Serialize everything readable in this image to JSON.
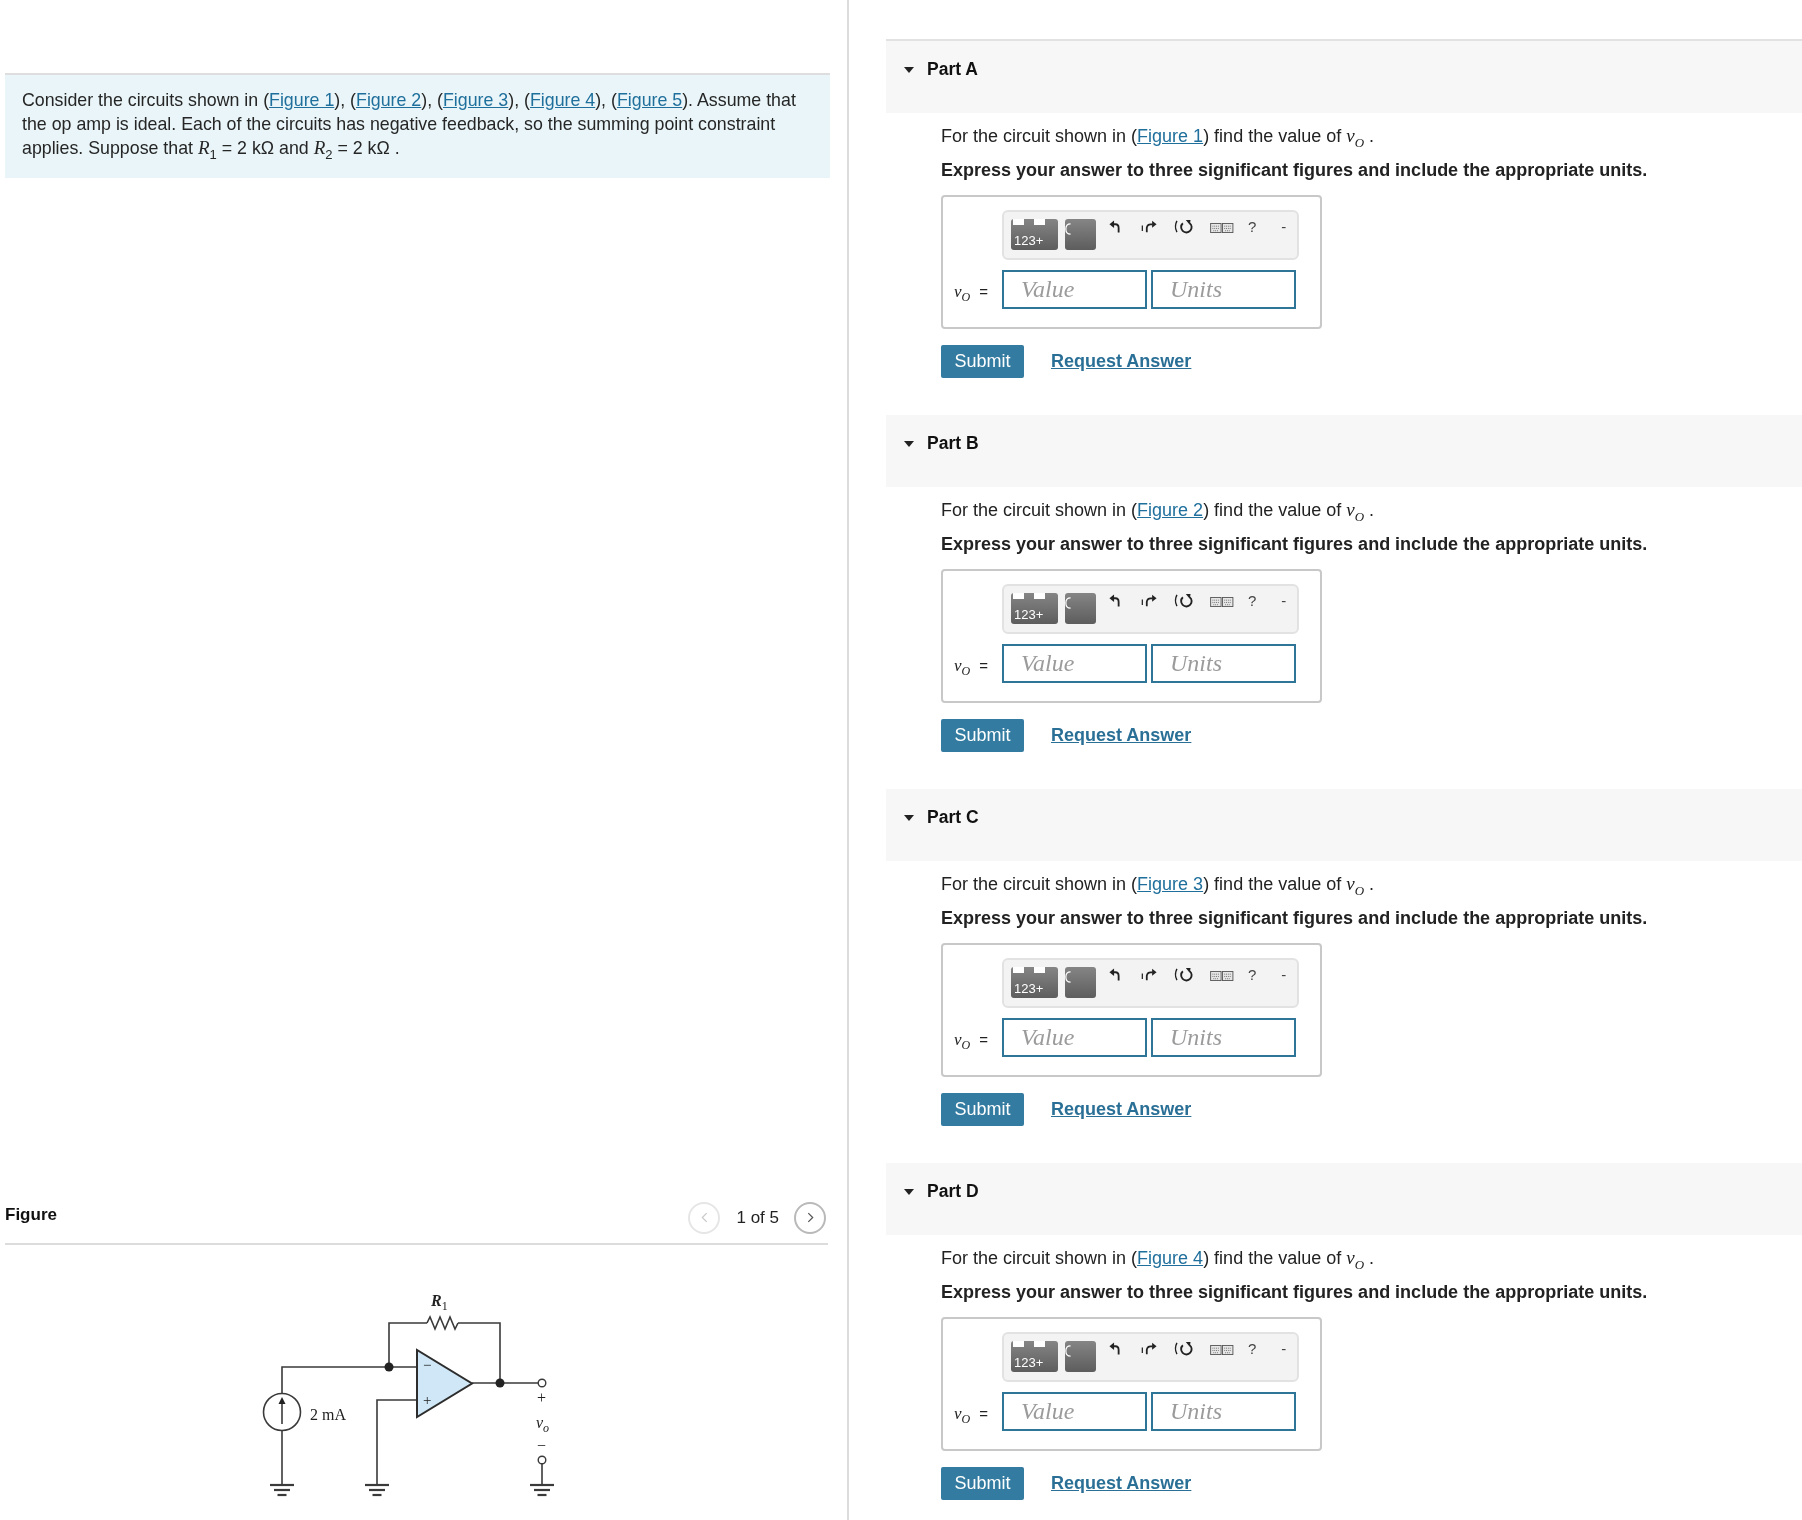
{
  "problem": {
    "segments": [
      {
        "kind": "text",
        "text": "Consider the circuits shown in ("
      },
      {
        "kind": "link",
        "text": "Figure 1"
      },
      {
        "kind": "text",
        "text": "), ("
      },
      {
        "kind": "link",
        "text": "Figure 2"
      },
      {
        "kind": "text",
        "text": "), ("
      },
      {
        "kind": "link",
        "text": "Figure 3"
      },
      {
        "kind": "text",
        "text": "), ("
      },
      {
        "kind": "link",
        "text": "Figure 4"
      },
      {
        "kind": "text",
        "text": "), ("
      },
      {
        "kind": "link",
        "text": "Figure 5"
      },
      {
        "kind": "text",
        "text": "). Assume that the op amp is ideal. Each of the circuits has negative feedback, so the summing point constraint applies. Suppose that *R*$_{1}$ = 2 kΩ and *R*$_{2}$ = 2 kΩ ."
      }
    ]
  },
  "figure": {
    "title": "Figure",
    "pager": {
      "label": "1 of 5",
      "previous": {
        "disabled": true
      },
      "next": {
        "disabled": false
      }
    },
    "circuit": {
      "resistor_label": "R$_{1}$",
      "source_label": "2 mA",
      "inverting_sign": "−",
      "noninverting_sign": "+",
      "output_plus": "+",
      "output_label": "v$_{o}$",
      "output_minus": "−"
    }
  },
  "parts": [
    {
      "title": "Part A",
      "expanded": true,
      "question": {
        "before": "For the circuit shown in (",
        "link": "Figure 1",
        "after": ") find the value of *v*$_{O}$ ."
      },
      "instruction": "Express your answer to three significant figures and include the appropriate units.",
      "answer": {
        "toolbar": [
          {
            "kind": "templates",
            "label": "123+"
          },
          {
            "kind": "symbols"
          },
          {
            "kind": "undo"
          },
          {
            "kind": "redo"
          },
          {
            "kind": "reset"
          },
          {
            "kind": "keyboard"
          },
          {
            "kind": "help",
            "label": "?"
          },
          {
            "kind": "more",
            "label": "-"
          }
        ],
        "variable": "v$_{O}$",
        "equals": "=",
        "value_placeholder": "Value",
        "units_placeholder": "Units"
      },
      "submit": "Submit",
      "request": "Request Answer"
    },
    {
      "title": "Part B",
      "expanded": true,
      "question": {
        "before": "For the circuit shown in (",
        "link": "Figure 2",
        "after": ") find the value of *v*$_{O}$ ."
      },
      "instruction": "Express your answer to three significant figures and include the appropriate units.",
      "answer": {
        "toolbar": [
          {
            "kind": "templates",
            "label": "123+"
          },
          {
            "kind": "symbols"
          },
          {
            "kind": "undo"
          },
          {
            "kind": "redo"
          },
          {
            "kind": "reset"
          },
          {
            "kind": "keyboard"
          },
          {
            "kind": "help",
            "label": "?"
          },
          {
            "kind": "more",
            "label": "-"
          }
        ],
        "variable": "v$_{O}$",
        "equals": "=",
        "value_placeholder": "Value",
        "units_placeholder": "Units"
      },
      "submit": "Submit",
      "request": "Request Answer"
    },
    {
      "title": "Part C",
      "expanded": true,
      "question": {
        "before": "For the circuit shown in (",
        "link": "Figure 3",
        "after": ") find the value of *v*$_{O}$ ."
      },
      "instruction": "Express your answer to three significant figures and include the appropriate units.",
      "answer": {
        "toolbar": [
          {
            "kind": "templates",
            "label": "123+"
          },
          {
            "kind": "symbols"
          },
          {
            "kind": "undo"
          },
          {
            "kind": "redo"
          },
          {
            "kind": "reset"
          },
          {
            "kind": "keyboard"
          },
          {
            "kind": "help",
            "label": "?"
          },
          {
            "kind": "more",
            "label": "-"
          }
        ],
        "variable": "v$_{O}$",
        "equals": "=",
        "value_placeholder": "Value",
        "units_placeholder": "Units"
      },
      "submit": "Submit",
      "request": "Request Answer"
    },
    {
      "title": "Part D",
      "expanded": true,
      "question": {
        "before": "For the circuit shown in (",
        "link": "Figure 4",
        "after": ") find the value of *v*$_{O}$ ."
      },
      "instruction": "Express your answer to three significant figures and include the appropriate units.",
      "answer": {
        "toolbar": [
          {
            "kind": "templates",
            "label": "123+"
          },
          {
            "kind": "symbols"
          },
          {
            "kind": "undo"
          },
          {
            "kind": "redo"
          },
          {
            "kind": "reset"
          },
          {
            "kind": "keyboard"
          },
          {
            "kind": "help",
            "label": "?"
          },
          {
            "kind": "more",
            "label": "-"
          }
        ],
        "variable": "v$_{O}$",
        "equals": "=",
        "value_placeholder": "Value",
        "units_placeholder": "Units"
      },
      "submit": "Submit",
      "request": "Request Answer"
    }
  ]
}
